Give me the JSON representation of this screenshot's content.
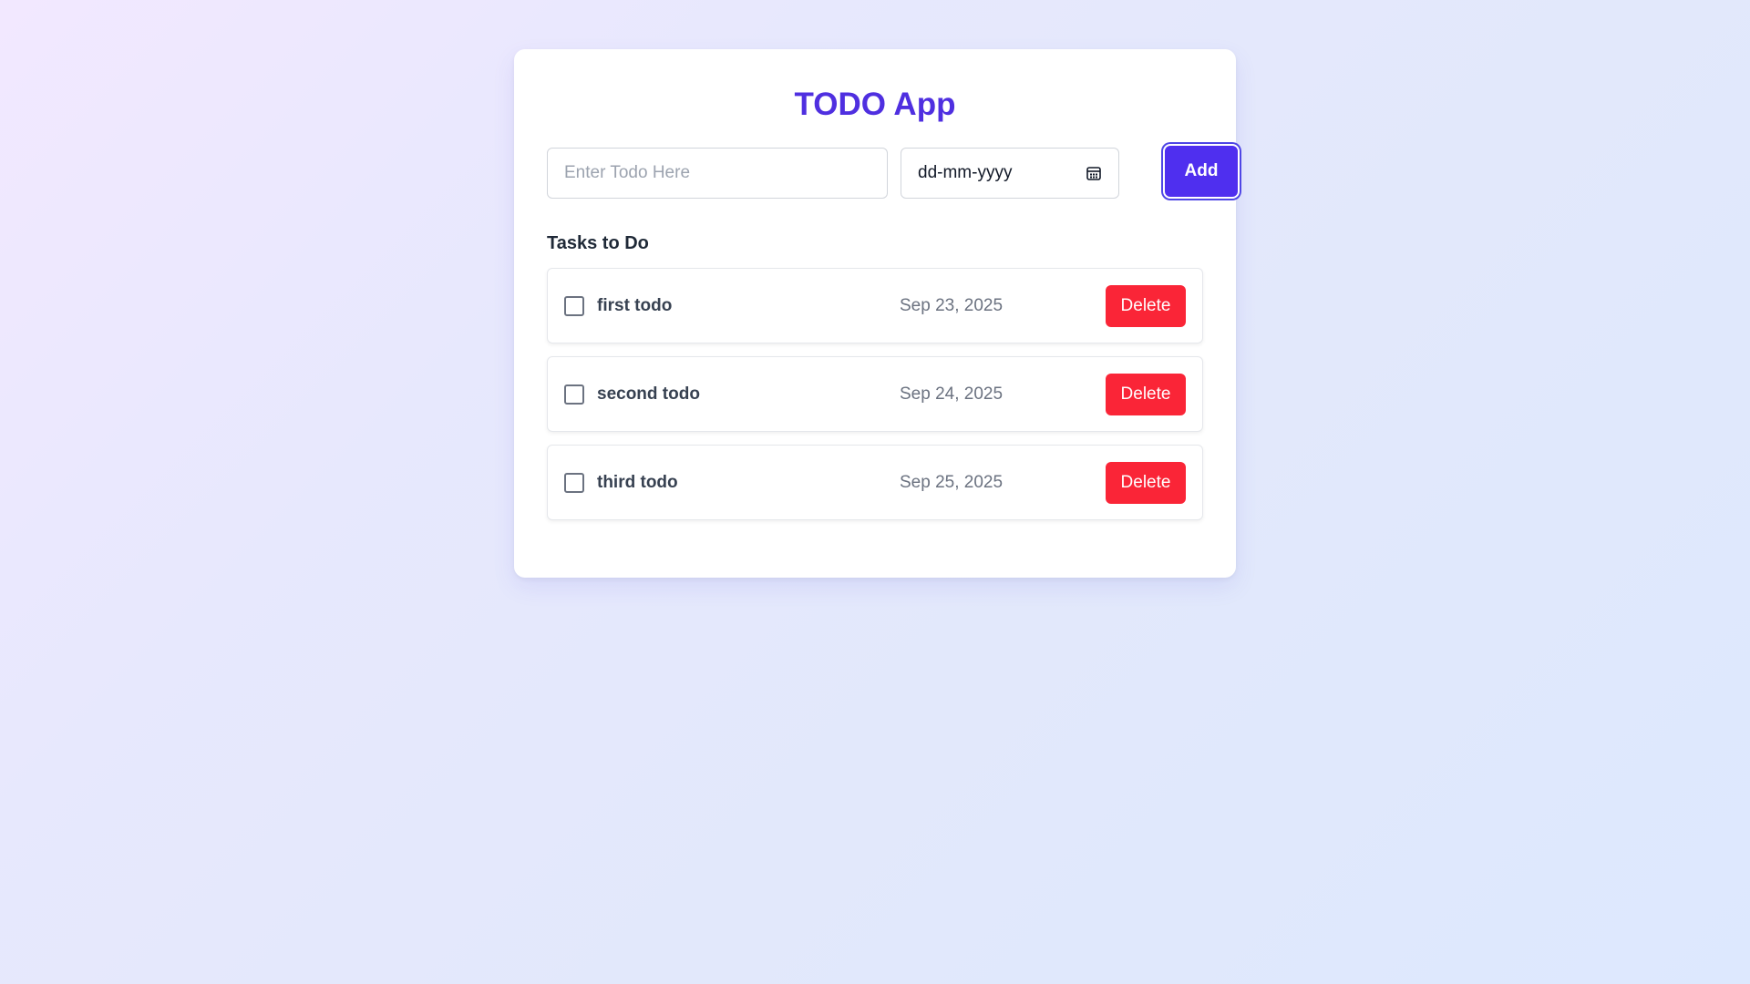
{
  "app": {
    "title": "TODO App"
  },
  "form": {
    "todo_placeholder": "Enter Todo Here",
    "date_placeholder": "dd-mm-yyyy",
    "date_icon": "calendar-icon",
    "add_label": "Add"
  },
  "list": {
    "heading": "Tasks to Do",
    "items": [
      {
        "name": "first todo",
        "date": "Sep 23, 2025",
        "done": false,
        "delete_label": "Delete"
      },
      {
        "name": "second todo",
        "date": "Sep 24, 2025",
        "done": false,
        "delete_label": "Delete"
      },
      {
        "name": "third todo",
        "date": "Sep 25, 2025",
        "done": false,
        "delete_label": "Delete"
      }
    ]
  },
  "colors": {
    "accent": "#4f2fef",
    "title": "#4f2fe0",
    "danger": "#fa2537"
  }
}
